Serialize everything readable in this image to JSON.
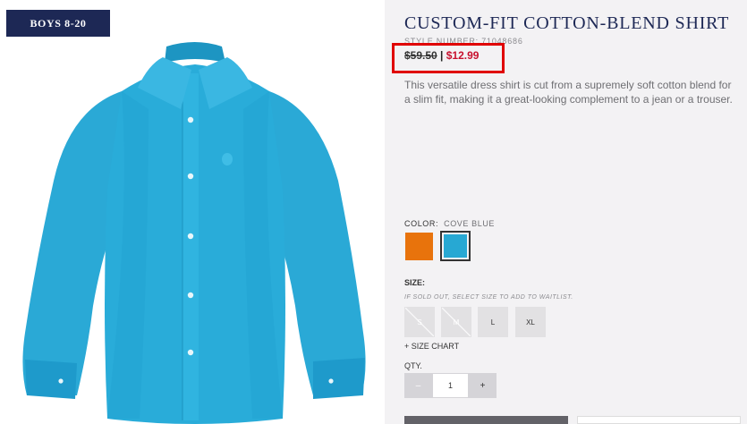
{
  "badge": "BOYS 8-20",
  "product": {
    "title": "CUSTOM-FIT COTTON-BLEND SHIRT",
    "style_number": "STYLE NUMBER: 71048686",
    "price_old": "$59.50",
    "price_sep": " | ",
    "price_new": "$12.99",
    "description": "This versatile dress shirt is cut from a supremely soft cotton blend for a slim fit, making it a great-looking complement to a jean or a trouser."
  },
  "color": {
    "label": "COLOR:",
    "value": "COVE BLUE",
    "swatches": [
      {
        "name": "orange",
        "hex": "#e8730c"
      },
      {
        "name": "cove-blue",
        "hex": "#27a8d3",
        "selected": true
      }
    ]
  },
  "size": {
    "label": "SIZE:",
    "note": "IF SOLD OUT, SELECT SIZE TO ADD TO WAITLIST.",
    "options": [
      {
        "label": "S",
        "sold_out": true
      },
      {
        "label": "M",
        "sold_out": true
      },
      {
        "label": "L",
        "sold_out": false
      },
      {
        "label": "XL",
        "sold_out": false
      }
    ],
    "chart_link": "+ SIZE CHART"
  },
  "quantity": {
    "label": "QTY.",
    "minus": "–",
    "plus": "+",
    "value": "1"
  },
  "colors": {
    "badge_bg": "#1d2855",
    "sale_red": "#c8102e",
    "highlight": "#e00000",
    "shirt": "#27a8d3"
  }
}
